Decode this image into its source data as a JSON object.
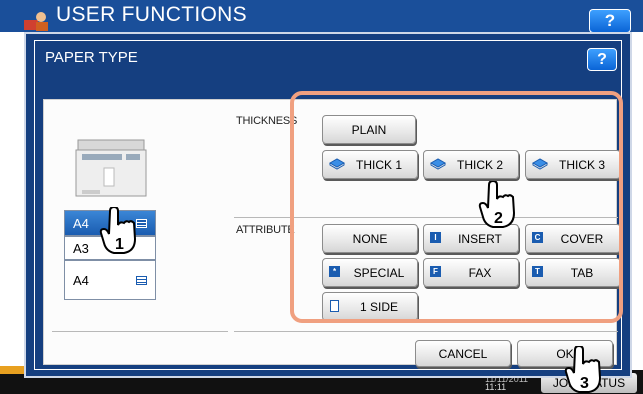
{
  "app": {
    "title": "USER FUNCTIONS",
    "help_label": "?",
    "date": "11/11/2011",
    "time": "11:11",
    "job_status_label": "JOB STATUS"
  },
  "dialog": {
    "title": "PAPER TYPE",
    "help_label": "?"
  },
  "drawers": [
    {
      "label": "A4",
      "selected": true,
      "icon": "landscape-paper-icon"
    },
    {
      "label": "A3",
      "selected": false,
      "icon": ""
    },
    {
      "label": "A4",
      "selected": false,
      "icon": "landscape-paper-icon"
    }
  ],
  "thickness": {
    "label": "THICKNESS",
    "buttons": [
      {
        "label": "PLAIN",
        "icon": ""
      },
      {
        "label": "THICK 1",
        "icon": "paper-thick-1-icon"
      },
      {
        "label": "THICK 2",
        "icon": "paper-thick-2-icon"
      },
      {
        "label": "THICK 3",
        "icon": "paper-thick-3-icon"
      }
    ]
  },
  "attribute": {
    "label": "ATTRIBUTE",
    "buttons": [
      {
        "label": "NONE",
        "icon": ""
      },
      {
        "label": "INSERT",
        "icon": "insert-icon"
      },
      {
        "label": "COVER",
        "icon": "cover-icon"
      },
      {
        "label": "SPECIAL",
        "icon": "special-icon"
      },
      {
        "label": "FAX",
        "icon": "fax-icon"
      },
      {
        "label": "TAB",
        "icon": "tab-icon"
      },
      {
        "label": "1 SIDE",
        "icon": "one-side-icon"
      }
    ]
  },
  "actions": {
    "cancel_label": "CANCEL",
    "ok_label": "OK"
  },
  "callouts": [
    "1",
    "2",
    "3"
  ],
  "colors": {
    "header": "#1a4f9a",
    "dialog": "#153f80",
    "selected_drawer": "#1a5cb0",
    "highlight": "#f0a080"
  }
}
